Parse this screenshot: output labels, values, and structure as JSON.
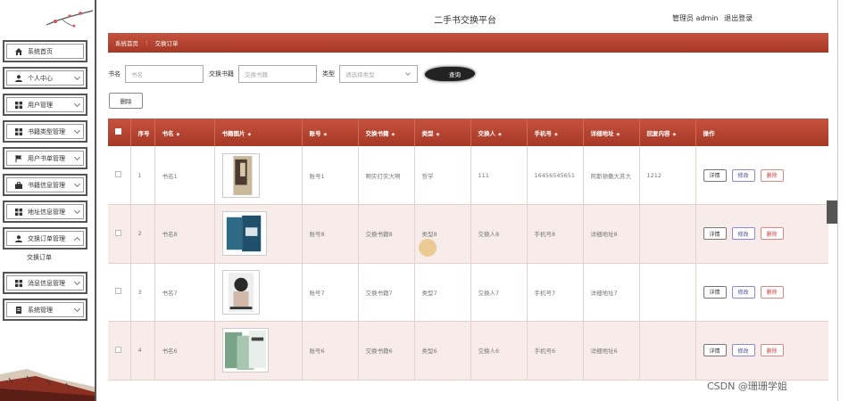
{
  "header": {
    "title": "二手书交换平台",
    "user_label": "管理员 admin",
    "logout": "退出登录"
  },
  "sidebar": {
    "items": [
      {
        "label": "系统首页",
        "icon": "home-icon"
      },
      {
        "label": "个人中心",
        "icon": "user-icon"
      },
      {
        "label": "用户管理",
        "icon": "grid-icon"
      },
      {
        "label": "书籍类型管理",
        "icon": "grid-icon"
      },
      {
        "label": "用户书单管理",
        "icon": "flag-icon"
      },
      {
        "label": "书籍信息管理",
        "icon": "briefcase-icon"
      },
      {
        "label": "地址信息管理",
        "icon": "grid-icon"
      },
      {
        "label": "交换订单管理",
        "icon": "user-icon"
      },
      {
        "label": "消息信息管理",
        "icon": "grid-icon"
      },
      {
        "label": "系统管理",
        "icon": "document-icon"
      }
    ],
    "sub_item": "交换订单"
  },
  "breadcrumb": {
    "home": "系统首页",
    "separator": "⋮",
    "current": "交换订单"
  },
  "search": {
    "name_label": "书名",
    "name_placeholder": "书名",
    "exchange_label": "交换书籍",
    "exchange_placeholder": "交换书籍",
    "type_label": "类型",
    "type_placeholder": "请选择类型",
    "query_button": "查询"
  },
  "toolbar": {
    "delete_label": "删除"
  },
  "table": {
    "headers": [
      "序号",
      "书名",
      "书籍图片",
      "账号",
      "交换书籍",
      "类型",
      "交换人",
      "手机号",
      "详细地址",
      "回复内容",
      "操作"
    ],
    "rows": [
      {
        "no": "1",
        "name": "书名1",
        "account": "账号1",
        "exchange": "啊实打实大啊",
        "type": "哲学",
        "person": "111",
        "phone": "16456545651",
        "address": "阿斯顿撒大苏大",
        "reply": "1212"
      },
      {
        "no": "2",
        "name": "书名8",
        "account": "账号8",
        "exchange": "交换书籍8",
        "type": "类型8",
        "person": "交换人8",
        "phone": "手机号8",
        "address": "详细地址8",
        "reply": ""
      },
      {
        "no": "3",
        "name": "书名7",
        "account": "账号7",
        "exchange": "交换书籍7",
        "type": "类型7",
        "person": "交换人7",
        "phone": "手机号7",
        "address": "详细地址7",
        "reply": ""
      },
      {
        "no": "4",
        "name": "书名6",
        "account": "账号6",
        "exchange": "交换书籍6",
        "type": "类型6",
        "person": "交换人6",
        "phone": "手机号6",
        "address": "详细地址6",
        "reply": ""
      }
    ],
    "actions": {
      "detail": "详情",
      "edit": "修改",
      "delete": "删除"
    }
  },
  "watermark": "CSDN @珊珊学姐",
  "colors": {
    "accent": "#b0402c",
    "row_alt": "#f8ecea"
  }
}
